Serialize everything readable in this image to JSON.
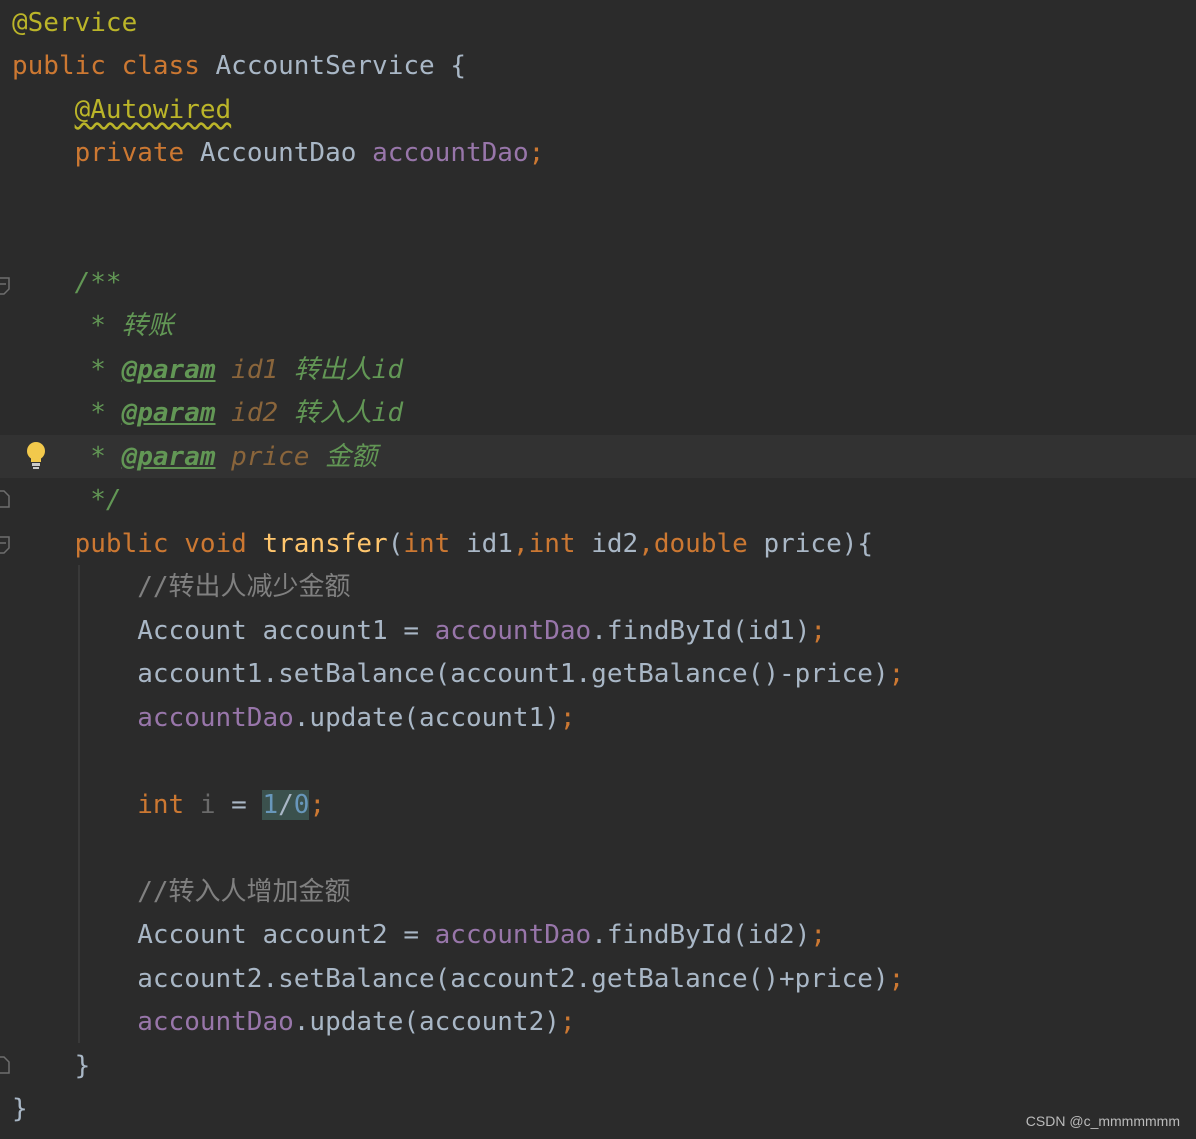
{
  "code": {
    "l1": {
      "ann": "@Service"
    },
    "l2": {
      "kw1": "public",
      "kw2": "class",
      "name": "AccountService",
      "brace": "{"
    },
    "l3": {
      "ann": "@Autowired"
    },
    "l4": {
      "kw": "private",
      "type": "AccountDao",
      "field": "accountDao",
      "semi": ";"
    },
    "l5": {
      "open": "/**"
    },
    "l6": {
      "star": "* ",
      "text": "转账"
    },
    "l7": {
      "star": "* ",
      "tag": "@param",
      "name": "id1",
      "desc": "转出人id"
    },
    "l8": {
      "star": "* ",
      "tag": "@param",
      "name": "id2",
      "desc": "转入人id"
    },
    "l9": {
      "star": "* ",
      "tag": "@param",
      "name": "price",
      "desc": "金额"
    },
    "l10": {
      "close": "*/"
    },
    "l11": {
      "kw1": "public",
      "kw2": "void",
      "fn": "transfer",
      "p1": "(",
      "t1": "int",
      "a1": " id1",
      "c1": ",",
      "t2": "int",
      "a2": " id2",
      "c2": ",",
      "t3": "double",
      "a3": " price){"
    },
    "l12": {
      "comment": "//转出人减少金额"
    },
    "l13": {
      "pre": "Account account1 = ",
      "field": "accountDao",
      "post": ".findById(id1)",
      "semi": ";"
    },
    "l14": {
      "text": "account1.setBalance(account1.getBalance()-price)",
      "semi": ";"
    },
    "l15": {
      "field": "accountDao",
      "post": ".update(account1)",
      "semi": ";"
    },
    "l16": {
      "kw": "int",
      "var": "i",
      "eq": " = ",
      "n1": "1",
      "op": "/",
      "n2": "0",
      "semi": ";"
    },
    "l17": {
      "comment": "//转入人增加金额"
    },
    "l18": {
      "pre": "Account account2 = ",
      "field": "accountDao",
      "post": ".findById(id2)",
      "semi": ";"
    },
    "l19": {
      "text": "account2.setBalance(account2.getBalance()+price)",
      "semi": ";"
    },
    "l20": {
      "field": "accountDao",
      "post": ".update(account2)",
      "semi": ";"
    },
    "l21": {
      "brace": "}"
    },
    "l22": {
      "brace": "}"
    }
  },
  "watermark": "CSDN @c_mmmmmmm",
  "colors": {
    "background": "#2b2b2b",
    "keyword": "#cc7832",
    "annotation": "#bbb529",
    "field": "#9876aa",
    "method": "#ffc66d",
    "number": "#6897bb",
    "comment": "#808080",
    "doc": "#629755",
    "text": "#a9b7c6"
  },
  "icons": {
    "gutter": [
      "fold-marker-icon",
      "lightbulb-icon"
    ]
  }
}
